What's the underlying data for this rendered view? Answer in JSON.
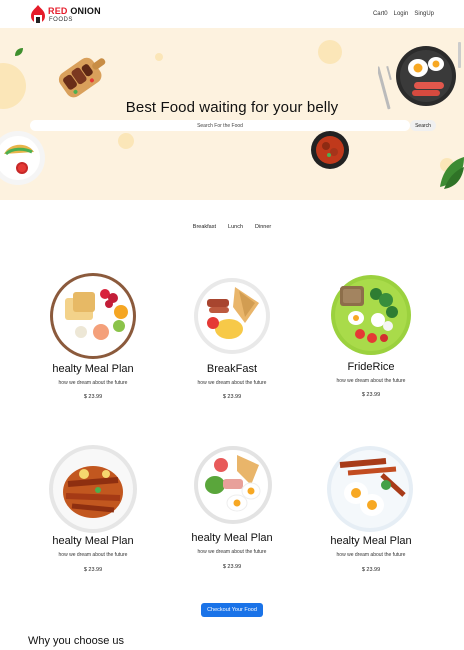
{
  "brand": {
    "name_red": "RED",
    "name_dark": "ONION",
    "sub": "FOODS"
  },
  "nav": {
    "links": [
      "Cart0",
      "Login",
      "SingUp"
    ]
  },
  "hero": {
    "title": "Best Food waiting for your belly",
    "search_placeholder": "Search For the Food",
    "search_button": "Search"
  },
  "tabs": [
    "Breakfast",
    "Lunch",
    "Dinner"
  ],
  "cards": [
    {
      "title": "healty Meal Plan",
      "desc": "how we dream about the future",
      "price": "$ 23.99"
    },
    {
      "title": "BreakFast",
      "desc": "how we dream about the future",
      "price": "$ 23.99"
    },
    {
      "title": "FrideRice",
      "desc": "how we dream about the future",
      "price": "$ 23.99"
    },
    {
      "title": "healty Meal Plan",
      "desc": "how we dream about the future",
      "price": "$ 23.99"
    },
    {
      "title": "healty Meal Plan",
      "desc": "how we dream about the future",
      "price": "$ 23.99"
    },
    {
      "title": "healty Meal Plan",
      "desc": "how we dream about the future",
      "price": "$ 23.99"
    }
  ],
  "checkout_label": "Checkout Your Food",
  "section_title": "Why you choose us",
  "colors": {
    "accent": "#e51c2a",
    "hero_bg": "#fdf2df",
    "button": "#1a73e8"
  }
}
